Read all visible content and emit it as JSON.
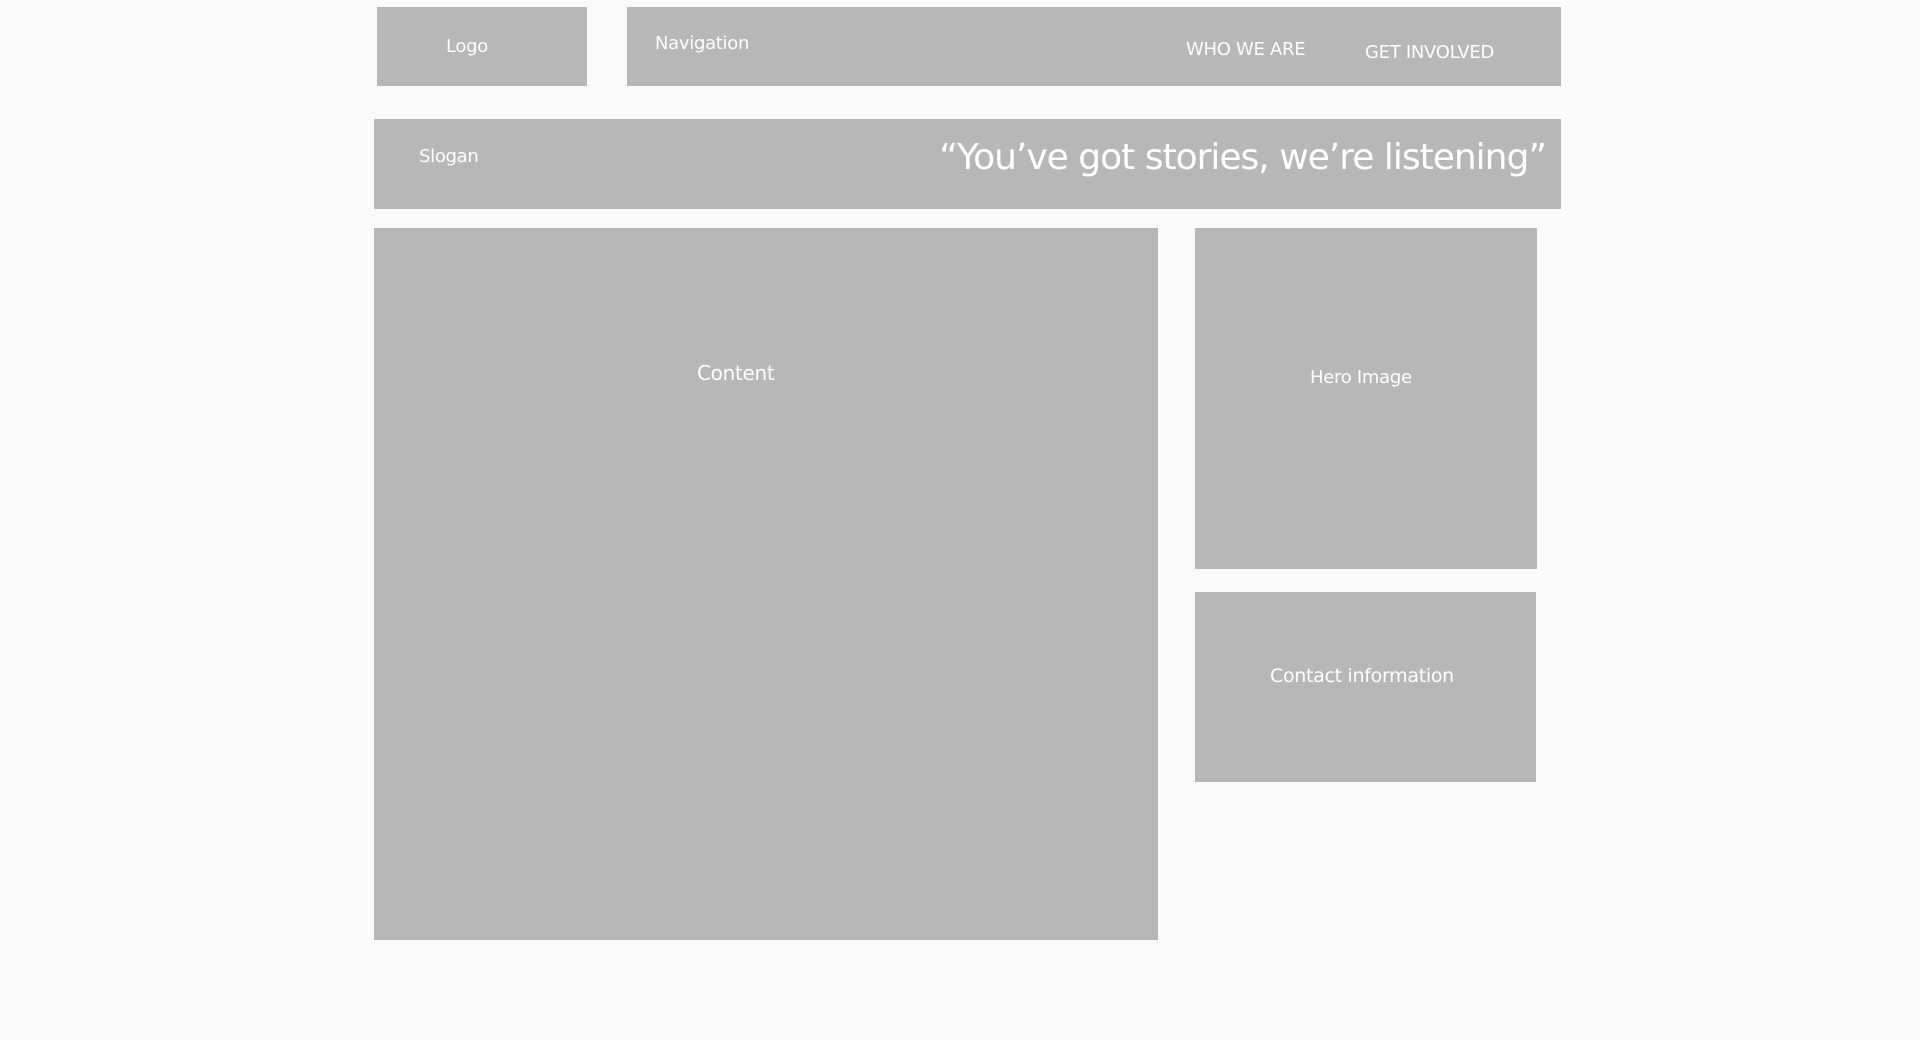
{
  "header": {
    "logo_label": "Logo",
    "navigation_label": "Navigation",
    "nav_items": [
      "WHO WE ARE",
      "GET INVOLVED"
    ]
  },
  "slogan": {
    "label": "Slogan",
    "quote": "“You’ve got stories, we’re listening”"
  },
  "main": {
    "content_label": "Content"
  },
  "sidebar": {
    "hero_label": "Hero Image",
    "contact_label": "Contact information"
  },
  "colors": {
    "page_background": "#fbf9fa",
    "block_fill": "#b7b7b7",
    "text": "#ffffff"
  }
}
